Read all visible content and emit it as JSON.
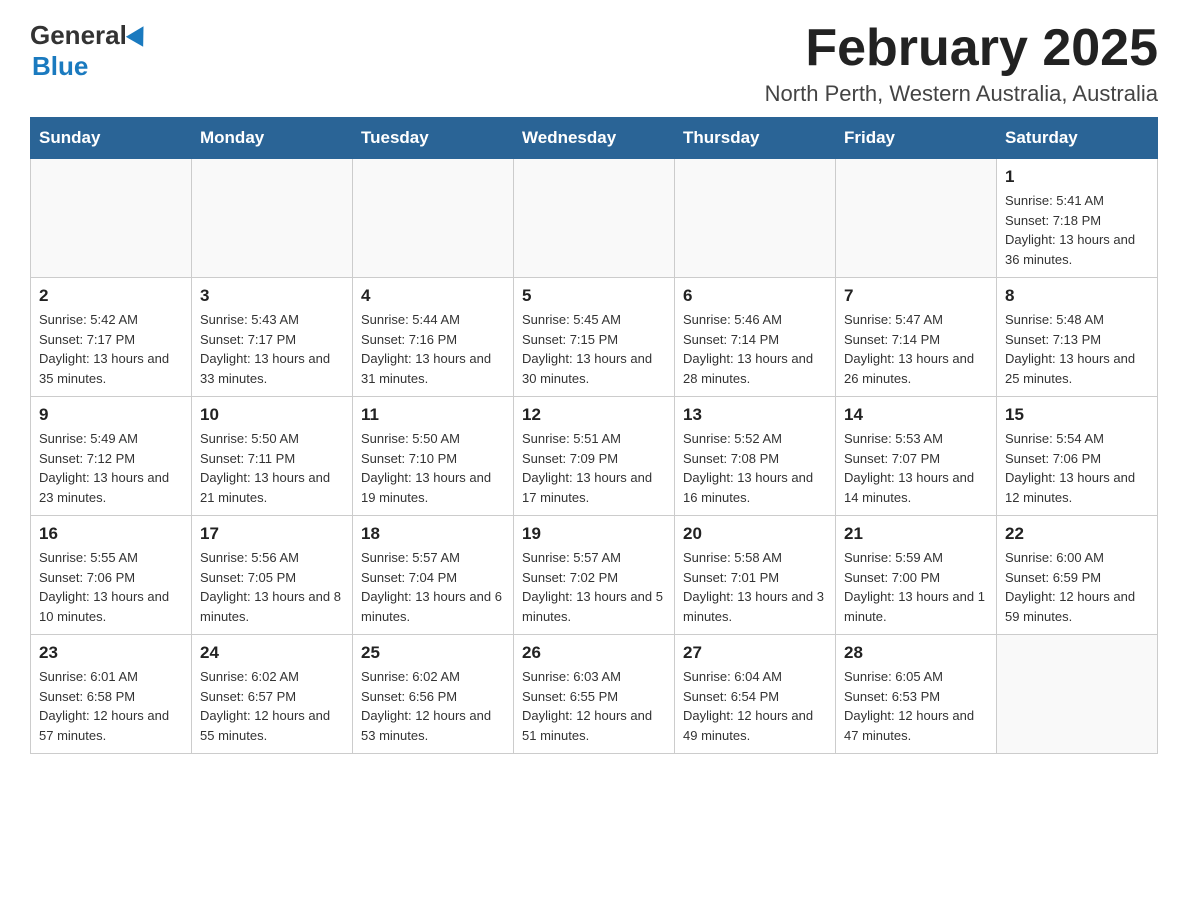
{
  "header": {
    "logo_general": "General",
    "logo_blue": "Blue",
    "title": "February 2025",
    "subtitle": "North Perth, Western Australia, Australia"
  },
  "days_of_week": [
    "Sunday",
    "Monday",
    "Tuesday",
    "Wednesday",
    "Thursday",
    "Friday",
    "Saturday"
  ],
  "weeks": [
    {
      "days": [
        {
          "number": "",
          "sunrise": "",
          "sunset": "",
          "daylight": ""
        },
        {
          "number": "",
          "sunrise": "",
          "sunset": "",
          "daylight": ""
        },
        {
          "number": "",
          "sunrise": "",
          "sunset": "",
          "daylight": ""
        },
        {
          "number": "",
          "sunrise": "",
          "sunset": "",
          "daylight": ""
        },
        {
          "number": "",
          "sunrise": "",
          "sunset": "",
          "daylight": ""
        },
        {
          "number": "",
          "sunrise": "",
          "sunset": "",
          "daylight": ""
        },
        {
          "number": "1",
          "sunrise": "Sunrise: 5:41 AM",
          "sunset": "Sunset: 7:18 PM",
          "daylight": "Daylight: 13 hours and 36 minutes."
        }
      ]
    },
    {
      "days": [
        {
          "number": "2",
          "sunrise": "Sunrise: 5:42 AM",
          "sunset": "Sunset: 7:17 PM",
          "daylight": "Daylight: 13 hours and 35 minutes."
        },
        {
          "number": "3",
          "sunrise": "Sunrise: 5:43 AM",
          "sunset": "Sunset: 7:17 PM",
          "daylight": "Daylight: 13 hours and 33 minutes."
        },
        {
          "number": "4",
          "sunrise": "Sunrise: 5:44 AM",
          "sunset": "Sunset: 7:16 PM",
          "daylight": "Daylight: 13 hours and 31 minutes."
        },
        {
          "number": "5",
          "sunrise": "Sunrise: 5:45 AM",
          "sunset": "Sunset: 7:15 PM",
          "daylight": "Daylight: 13 hours and 30 minutes."
        },
        {
          "number": "6",
          "sunrise": "Sunrise: 5:46 AM",
          "sunset": "Sunset: 7:14 PM",
          "daylight": "Daylight: 13 hours and 28 minutes."
        },
        {
          "number": "7",
          "sunrise": "Sunrise: 5:47 AM",
          "sunset": "Sunset: 7:14 PM",
          "daylight": "Daylight: 13 hours and 26 minutes."
        },
        {
          "number": "8",
          "sunrise": "Sunrise: 5:48 AM",
          "sunset": "Sunset: 7:13 PM",
          "daylight": "Daylight: 13 hours and 25 minutes."
        }
      ]
    },
    {
      "days": [
        {
          "number": "9",
          "sunrise": "Sunrise: 5:49 AM",
          "sunset": "Sunset: 7:12 PM",
          "daylight": "Daylight: 13 hours and 23 minutes."
        },
        {
          "number": "10",
          "sunrise": "Sunrise: 5:50 AM",
          "sunset": "Sunset: 7:11 PM",
          "daylight": "Daylight: 13 hours and 21 minutes."
        },
        {
          "number": "11",
          "sunrise": "Sunrise: 5:50 AM",
          "sunset": "Sunset: 7:10 PM",
          "daylight": "Daylight: 13 hours and 19 minutes."
        },
        {
          "number": "12",
          "sunrise": "Sunrise: 5:51 AM",
          "sunset": "Sunset: 7:09 PM",
          "daylight": "Daylight: 13 hours and 17 minutes."
        },
        {
          "number": "13",
          "sunrise": "Sunrise: 5:52 AM",
          "sunset": "Sunset: 7:08 PM",
          "daylight": "Daylight: 13 hours and 16 minutes."
        },
        {
          "number": "14",
          "sunrise": "Sunrise: 5:53 AM",
          "sunset": "Sunset: 7:07 PM",
          "daylight": "Daylight: 13 hours and 14 minutes."
        },
        {
          "number": "15",
          "sunrise": "Sunrise: 5:54 AM",
          "sunset": "Sunset: 7:06 PM",
          "daylight": "Daylight: 13 hours and 12 minutes."
        }
      ]
    },
    {
      "days": [
        {
          "number": "16",
          "sunrise": "Sunrise: 5:55 AM",
          "sunset": "Sunset: 7:06 PM",
          "daylight": "Daylight: 13 hours and 10 minutes."
        },
        {
          "number": "17",
          "sunrise": "Sunrise: 5:56 AM",
          "sunset": "Sunset: 7:05 PM",
          "daylight": "Daylight: 13 hours and 8 minutes."
        },
        {
          "number": "18",
          "sunrise": "Sunrise: 5:57 AM",
          "sunset": "Sunset: 7:04 PM",
          "daylight": "Daylight: 13 hours and 6 minutes."
        },
        {
          "number": "19",
          "sunrise": "Sunrise: 5:57 AM",
          "sunset": "Sunset: 7:02 PM",
          "daylight": "Daylight: 13 hours and 5 minutes."
        },
        {
          "number": "20",
          "sunrise": "Sunrise: 5:58 AM",
          "sunset": "Sunset: 7:01 PM",
          "daylight": "Daylight: 13 hours and 3 minutes."
        },
        {
          "number": "21",
          "sunrise": "Sunrise: 5:59 AM",
          "sunset": "Sunset: 7:00 PM",
          "daylight": "Daylight: 13 hours and 1 minute."
        },
        {
          "number": "22",
          "sunrise": "Sunrise: 6:00 AM",
          "sunset": "Sunset: 6:59 PM",
          "daylight": "Daylight: 12 hours and 59 minutes."
        }
      ]
    },
    {
      "days": [
        {
          "number": "23",
          "sunrise": "Sunrise: 6:01 AM",
          "sunset": "Sunset: 6:58 PM",
          "daylight": "Daylight: 12 hours and 57 minutes."
        },
        {
          "number": "24",
          "sunrise": "Sunrise: 6:02 AM",
          "sunset": "Sunset: 6:57 PM",
          "daylight": "Daylight: 12 hours and 55 minutes."
        },
        {
          "number": "25",
          "sunrise": "Sunrise: 6:02 AM",
          "sunset": "Sunset: 6:56 PM",
          "daylight": "Daylight: 12 hours and 53 minutes."
        },
        {
          "number": "26",
          "sunrise": "Sunrise: 6:03 AM",
          "sunset": "Sunset: 6:55 PM",
          "daylight": "Daylight: 12 hours and 51 minutes."
        },
        {
          "number": "27",
          "sunrise": "Sunrise: 6:04 AM",
          "sunset": "Sunset: 6:54 PM",
          "daylight": "Daylight: 12 hours and 49 minutes."
        },
        {
          "number": "28",
          "sunrise": "Sunrise: 6:05 AM",
          "sunset": "Sunset: 6:53 PM",
          "daylight": "Daylight: 12 hours and 47 minutes."
        },
        {
          "number": "",
          "sunrise": "",
          "sunset": "",
          "daylight": ""
        }
      ]
    }
  ]
}
